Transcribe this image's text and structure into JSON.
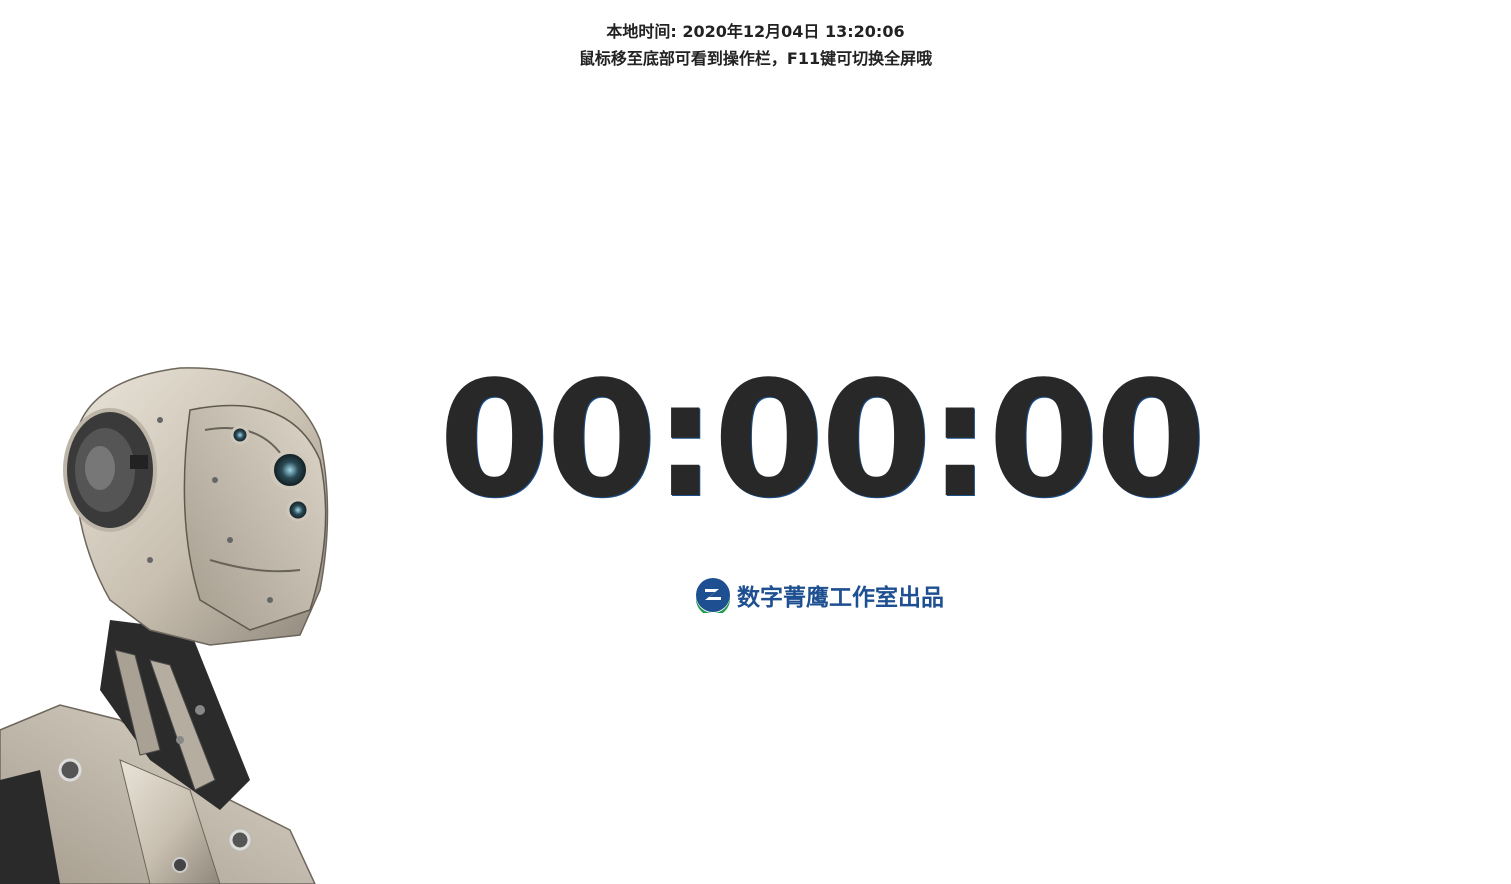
{
  "header": {
    "local_time": "本地时间: 2020年12月04日 13:20:06",
    "hint": "鼠标移至底部可看到操作栏，F11键可切换全屏哦"
  },
  "timer": {
    "display": "00:00:00"
  },
  "brand": {
    "logo_icon": "digital-eagle-logo-icon",
    "text": "数字菁鹰工作室出品",
    "color": "#1d4f91"
  },
  "decor": {
    "robot_image": "robot-illustration"
  },
  "colors": {
    "background": "#ffffff",
    "timer": "#282828",
    "header_text": "#222222"
  }
}
